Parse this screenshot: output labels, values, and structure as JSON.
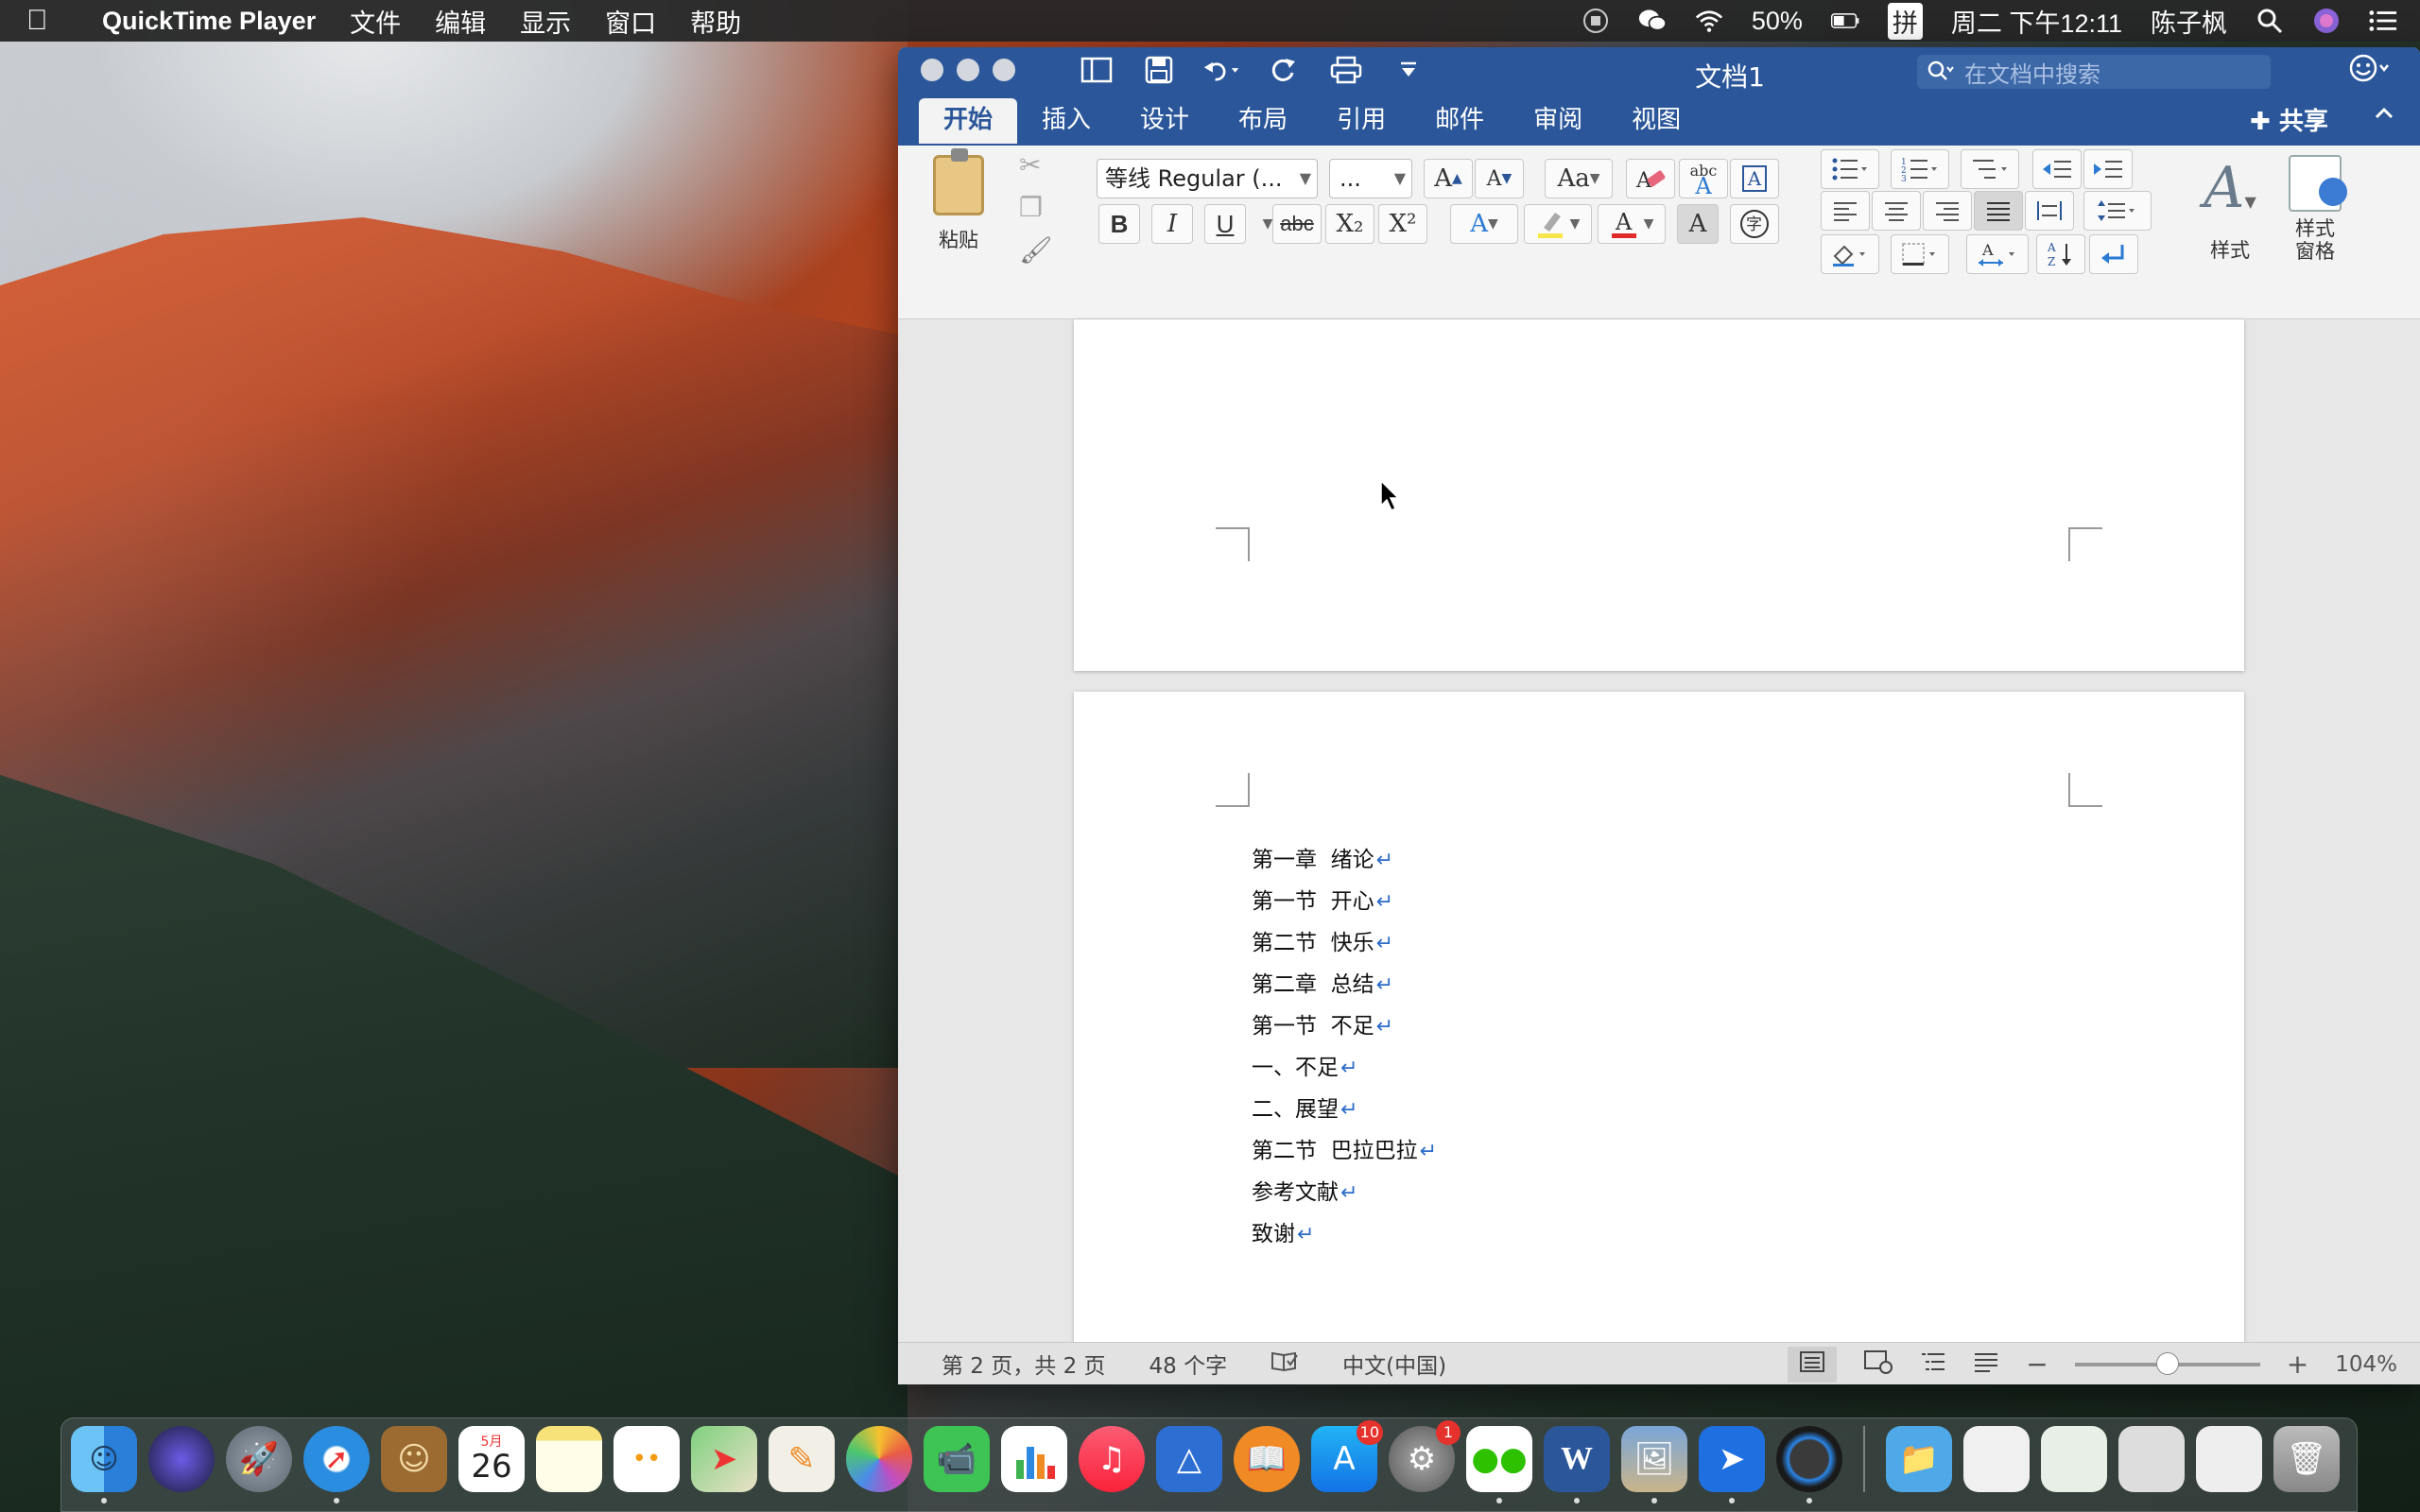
{
  "menubar": {
    "app_name": "QuickTime Player",
    "items": [
      "文件",
      "编辑",
      "显示",
      "窗口",
      "帮助"
    ],
    "battery": "50%",
    "input_method": "拼",
    "datetime": "周二 下午12:11",
    "user": "陈子枫"
  },
  "word": {
    "title": "文档1",
    "search_placeholder": "在文档中搜索",
    "tabs": [
      "开始",
      "插入",
      "设计",
      "布局",
      "引用",
      "邮件",
      "审阅",
      "视图"
    ],
    "share": "共享",
    "ribbon": {
      "paste": "粘贴",
      "font_name": "等线 Regular (...",
      "font_size": "...",
      "bold": "B",
      "italic": "I",
      "underline": "U",
      "strike": "abc",
      "subscript": "X₂",
      "superscript": "X²",
      "styles": "样式",
      "styles_pane": "样式\n窗格",
      "styles_pane_1": "样式",
      "styles_pane_2": "窗格",
      "abc": "abc"
    },
    "document": {
      "lines": [
        "第一章  绪论",
        "第一节  开心",
        "第二节  快乐",
        "第二章  总结",
        "第一节  不足",
        "一、不足",
        "二、展望",
        "第二节  巴拉巴拉",
        "参考文献",
        "致谢"
      ]
    },
    "statusbar": {
      "page": "第 2 页，共 2 页",
      "words": "48 个字",
      "language": "中文(中国)",
      "zoom": "104%",
      "zoom_fraction": 0.5
    }
  },
  "dock": {
    "calendar_month": "5月",
    "calendar_day": "26",
    "appstore_badge": "10",
    "settings_badge": "1"
  }
}
